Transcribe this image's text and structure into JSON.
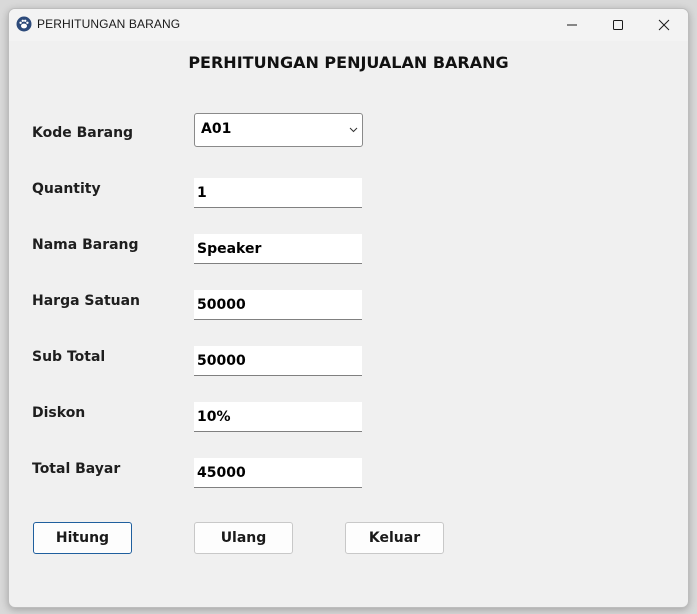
{
  "window": {
    "title": "PERHITUNGAN BARANG",
    "app_icon": "paw-icon"
  },
  "form": {
    "heading": "PERHITUNGAN PENJUALAN BARANG",
    "kode_barang": {
      "label": "Kode Barang",
      "value": "A01"
    },
    "quantity": {
      "label": "Quantity",
      "value": "1"
    },
    "nama_barang": {
      "label": "Nama Barang",
      "value": "Speaker"
    },
    "harga_satuan": {
      "label": "Harga Satuan",
      "value": "50000"
    },
    "sub_total": {
      "label": "Sub Total",
      "value": "50000"
    },
    "diskon": {
      "label": "Diskon",
      "value": "10%"
    },
    "total_bayar": {
      "label": "Total Bayar",
      "value": "45000"
    }
  },
  "buttons": {
    "hitung": "Hitung",
    "ulang": "Ulang",
    "keluar": "Keluar"
  },
  "colors": {
    "window_bg": "#f0f0f0",
    "default_button_border": "#1f5f9e"
  }
}
